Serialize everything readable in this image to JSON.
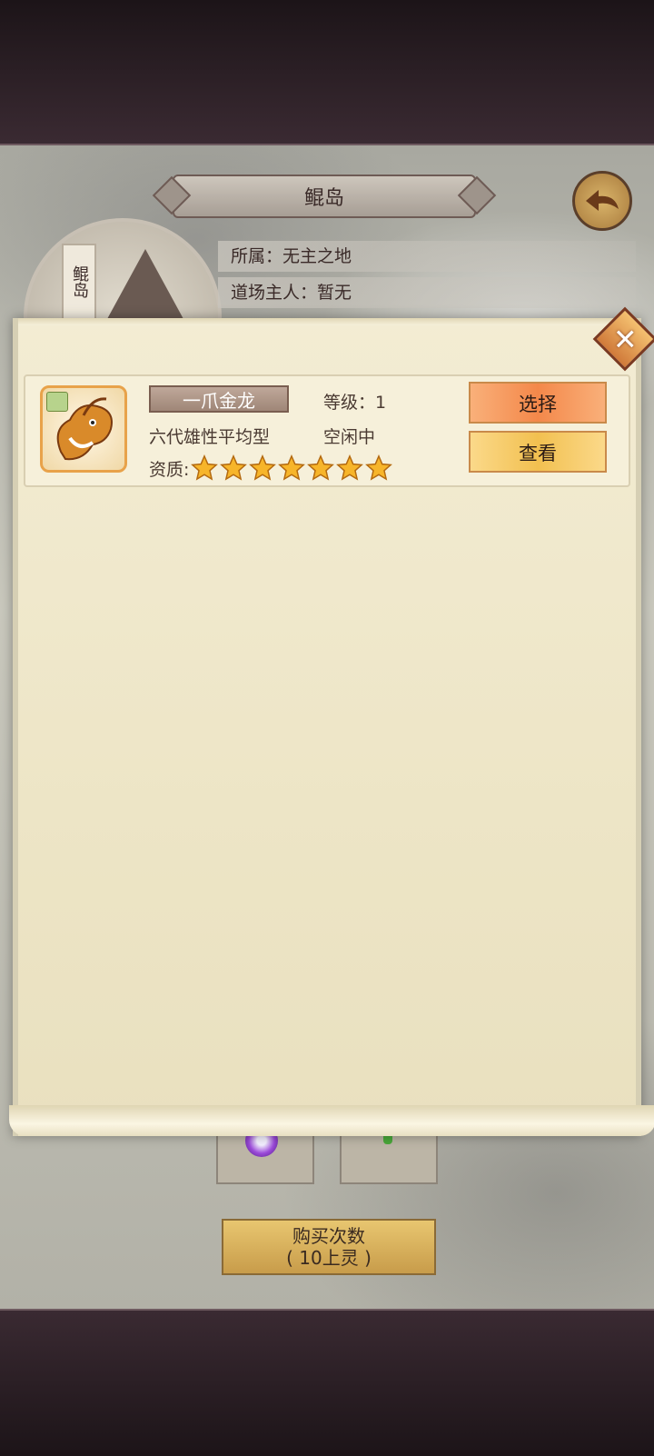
{
  "header": {
    "island_name": "鲲岛",
    "side_tag": "鲲岛",
    "affiliation": "所属：无主之地",
    "owner": "道场主人：暂无"
  },
  "pet_list": [
    {
      "name": "一爪金龙",
      "level_label": "等级：1",
      "type": "六代雄性平均型",
      "status": "空闲中",
      "quality_label": "资质:",
      "stars": 7,
      "select_label": "选择",
      "view_label": "查看"
    }
  ],
  "bottom": {
    "buy_label_line1": "购买次数",
    "buy_label_line2": "( 10上灵 )"
  },
  "icons": {
    "back": "back-arrow-icon",
    "close": "close-icon",
    "star": "star-icon"
  },
  "colors": {
    "select_button": "#f4884a",
    "view_button": "#f2c050",
    "scroll_bg": "#ede5c6"
  }
}
